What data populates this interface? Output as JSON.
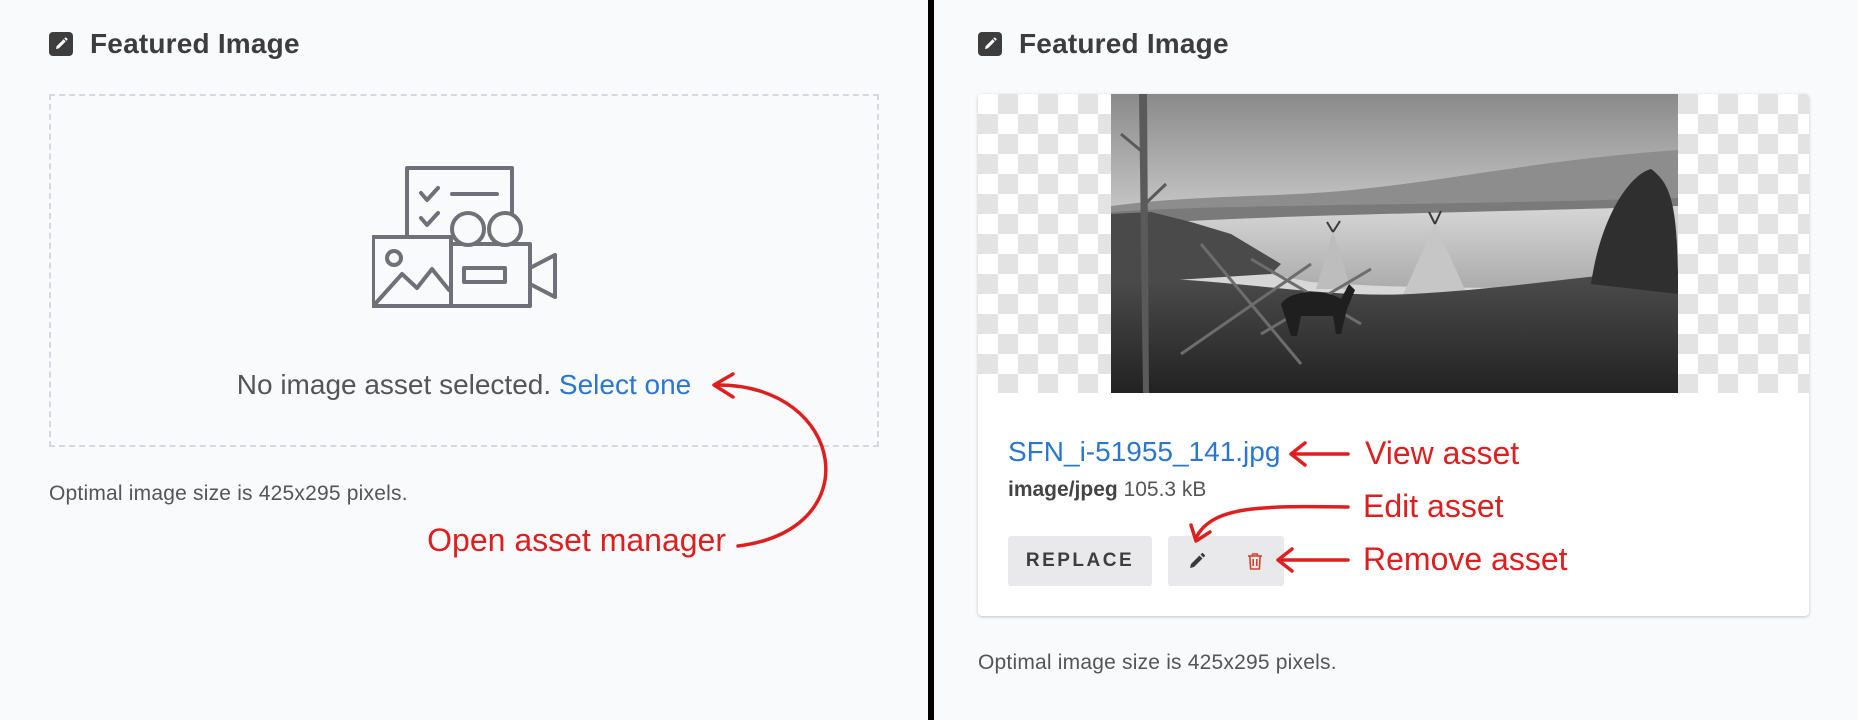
{
  "left_panel": {
    "header": {
      "title": "Featured Image",
      "icon": "pencil-square-icon"
    },
    "empty_state": {
      "message": "No image asset selected.",
      "link": "Select one",
      "graphic": "media-assets-placeholder-icon"
    },
    "hint": "Optimal image size is 425x295 pixels.",
    "annotation": "Open asset manager"
  },
  "right_panel": {
    "header": {
      "title": "Featured Image",
      "icon": "pencil-square-icon"
    },
    "asset": {
      "filename": "SFN_i-51955_141.jpg",
      "mime": "image/jpeg",
      "size": "105.3 kB"
    },
    "actions": {
      "replace": "REPLACE",
      "edit_icon": "pencil-icon",
      "remove_icon": "trash-icon"
    },
    "hint": "Optimal image size is 425x295 pixels.",
    "annotations": {
      "view": "View asset",
      "edit": "Edit asset",
      "remove": "Remove asset"
    }
  },
  "colors": {
    "background": "#f9fafc",
    "link": "#2b76cf",
    "annotation": "#dd1f1f",
    "divider": "#000000",
    "remove_icon": "#d0452f"
  }
}
